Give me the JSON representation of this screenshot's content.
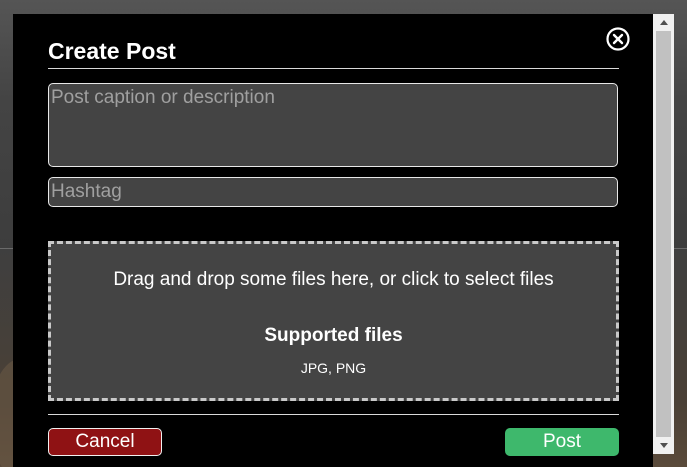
{
  "modal": {
    "title": "Create Post",
    "close_icon": "close-circle-icon"
  },
  "form": {
    "caption_placeholder": "Post caption or description",
    "caption_value": "",
    "hashtag_placeholder": "Hashtag",
    "hashtag_value": ""
  },
  "dropzone": {
    "instruction": "Drag and drop some files here, or click to select files",
    "supported_heading": "Supported files",
    "supported_types": "JPG, PNG"
  },
  "actions": {
    "cancel_label": "Cancel",
    "post_label": "Post"
  },
  "colors": {
    "cancel": "#8f1214",
    "post": "#3eb86c",
    "modal_bg": "#000000",
    "field_bg": "#444444"
  }
}
